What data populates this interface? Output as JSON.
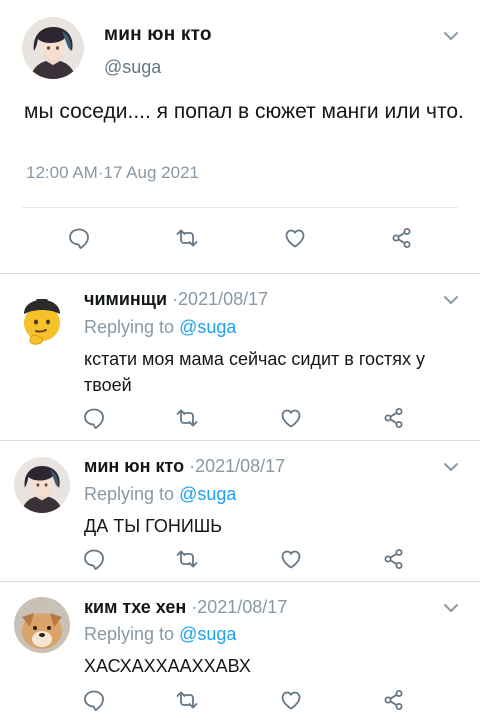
{
  "main_tweet": {
    "name": "мин юн кто",
    "handle": "@suga",
    "text": "мы соседи.... я попал в сюжет манги или что.",
    "timestamp": "12:00 AM·17 Aug 2021"
  },
  "replies": [
    {
      "name": "чиминщи",
      "date": "·2021/08/17",
      "replying_prefix": "Replying to ",
      "replying_handle": "@suga",
      "text": "кстати моя мама сейчас сидит в гостях у твоей"
    },
    {
      "name": "мин юн кто",
      "date": "·2021/08/17",
      "replying_prefix": "Replying to ",
      "replying_handle": "@suga",
      "text": "ДА ТЫ ГОНИШЬ"
    },
    {
      "name": "ким тхе хен",
      "date": "·2021/08/17",
      "replying_prefix": "Replying to ",
      "replying_handle": "@suga",
      "text": "ХАСХАХХААХХАВХ"
    }
  ],
  "icons": {
    "reply": "reply-bubble-icon",
    "retweet": "retweet-icon",
    "like": "heart-icon",
    "share": "share-icon",
    "menu": "chevron-down-icon"
  },
  "colors": {
    "mention": "#1da1f2",
    "muted": "#8899a6",
    "icon": "#657786"
  }
}
